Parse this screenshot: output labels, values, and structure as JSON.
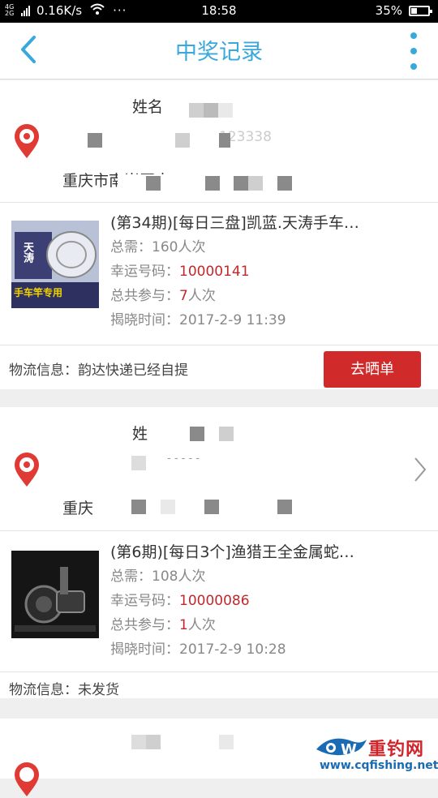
{
  "status_bar": {
    "network": "4G 2G",
    "speed": "0.16K/s",
    "more": "···",
    "time": "18:58",
    "battery": "35%",
    "battery_level": 0.35
  },
  "header": {
    "title": "中奖记录"
  },
  "records": [
    {
      "address": {
        "name_label": "姓名",
        "phone_fragment": "123338",
        "address_line": "重庆市南岸区南"
      },
      "product": {
        "title": "(第34期)[每日三盘]凯蓝.天涛手车…",
        "need_label": "总需：",
        "need_value": "160人次",
        "lucky_label": "幸运号码：",
        "lucky_value": "10000141",
        "joined_label": "总共参与：",
        "joined_value": "7",
        "joined_unit": "人次",
        "reveal_label": "揭晓时间：",
        "reveal_value": "2017-2-9 11:39",
        "image_text": "手车竿专用",
        "image_brand": "天涛"
      },
      "logistics": "物流信息：韵达快递已经自提",
      "action": "去晒单"
    },
    {
      "address": {
        "name_label": "姓",
        "phone_fragment": "- - - - -",
        "address_line": "重庆"
      },
      "product": {
        "title": "(第6期)[每日3个]渔猎王全金属蛇…",
        "need_label": "总需：",
        "need_value": "108人次",
        "lucky_label": "幸运号码：",
        "lucky_value": "10000086",
        "joined_label": "总共参与：",
        "joined_value": "1",
        "joined_unit": "人次",
        "reveal_label": "揭晓时间：",
        "reveal_value": "2017-2-9 10:28"
      },
      "logistics": "物流信息：未发货"
    }
  ],
  "watermark": {
    "brand": "重钓网",
    "url": "www.cqfishing.net"
  },
  "colors": {
    "accent": "#39a9dc",
    "danger": "#d12a2a",
    "lucky": "#c0282c",
    "pin": "#e03a35"
  }
}
